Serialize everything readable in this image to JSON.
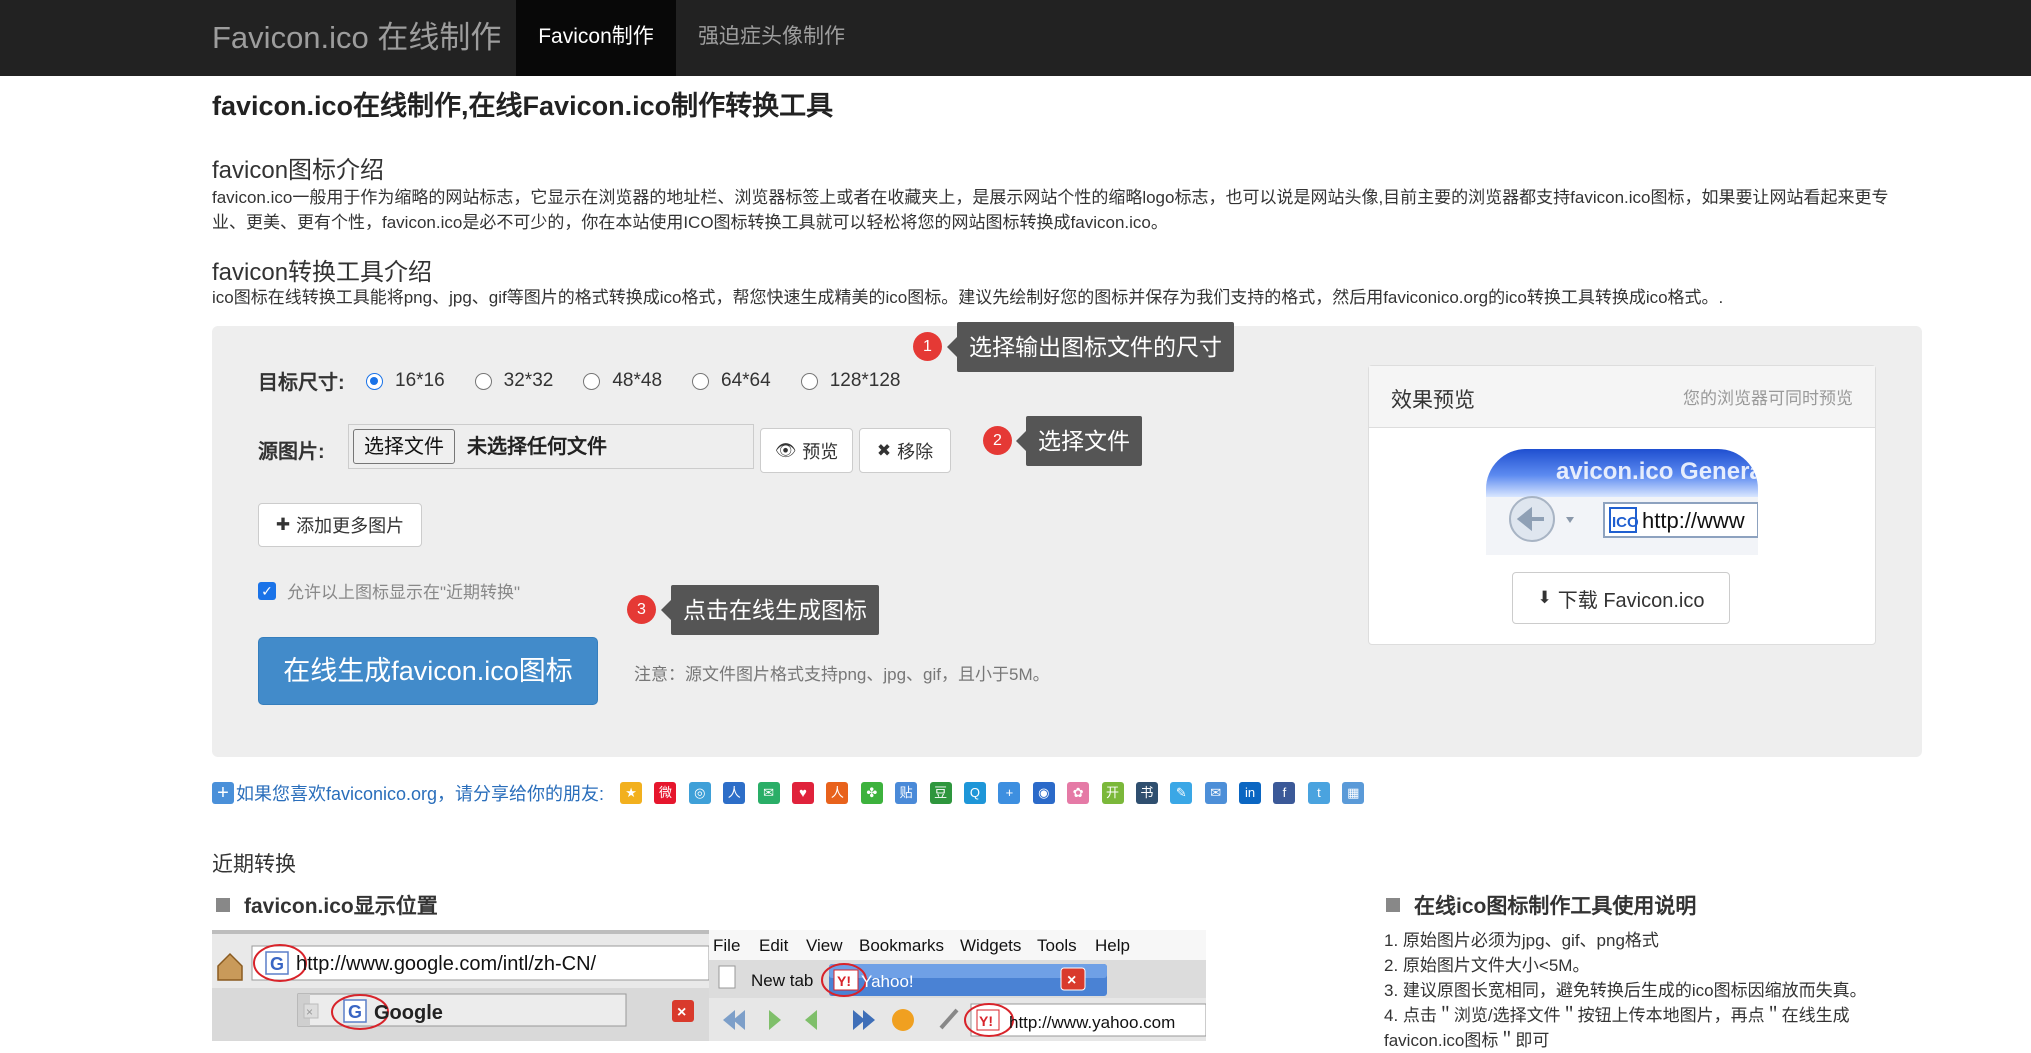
{
  "navbar": {
    "brand": "Favicon.ico 在线制作",
    "items": [
      {
        "label": "Favicon制作",
        "active": true
      },
      {
        "label": "强迫症头像制作",
        "active": false
      }
    ]
  },
  "page_title": "favicon.ico在线制作,在线Favicon.ico制作转换工具",
  "intro": {
    "heading": "favicon图标介绍",
    "text": "favicon.ico一般用于作为缩略的网站标志，它显示在浏览器的地址栏、浏览器标签上或者在收藏夹上，是展示网站个性的缩略logo标志，也可以说是网站头像,目前主要的浏览器都支持favicon.ico图标，如果要让网站看起来更专业、更美、更有个性，favicon.ico是必不可少的，你在本站使用ICO图标转换工具就可以轻松将您的网站图标转换成favicon.ico。"
  },
  "tool_intro": {
    "heading": "favicon转换工具介绍",
    "text": "ico图标在线转换工具能将png、jpg、gif等图片的格式转换成ico格式，帮您快速生成精美的ico图标。建议先绘制好您的图标并保存为我们支持的格式，然后用faviconico.org的ico转换工具转换成ico格式。."
  },
  "form": {
    "size_label": "目标尺寸:",
    "sizes": [
      "16*16",
      "32*32",
      "48*48",
      "64*64",
      "128*128"
    ],
    "selected_size": "16*16",
    "source_label": "源图片:",
    "file_button": "选择文件",
    "file_status": "未选择任何文件",
    "preview_button": "预览",
    "remove_button": "移除",
    "add_more_button": "添加更多图片",
    "allow_recent_label": "允许以上图标显示在\"近期转换\"",
    "allow_recent_checked": true,
    "generate_button": "在线生成favicon.ico图标",
    "note": "注意：源文件图片格式支持png、jpg、gif，且小于5M。"
  },
  "tips": [
    {
      "num": "1",
      "text": "选择输出图标文件的尺寸"
    },
    {
      "num": "2",
      "text": "选择文件"
    },
    {
      "num": "3",
      "text": "点击在线生成图标"
    }
  ],
  "preview": {
    "title": "效果预览",
    "hint": "您的浏览器可同时预览",
    "image_caption": "avicon.ico Genera",
    "image_url_text": "http://www",
    "image_ico_text": "ICO",
    "download_button": "下载 Favicon.ico"
  },
  "share": {
    "text": "如果您喜欢faviconico.org，请分享给你的朋友:",
    "icons": [
      {
        "name": "qzone-icon",
        "color": "#f2b01e"
      },
      {
        "name": "weibo-icon",
        "color": "#e6162d"
      },
      {
        "name": "tencent-weibo-icon",
        "color": "#3fa0d8"
      },
      {
        "name": "baidu-icon",
        "color": "#2d6ec8"
      },
      {
        "name": "wechat-icon",
        "color": "#2aae67"
      },
      {
        "name": "heart-icon",
        "color": "#e0223b"
      },
      {
        "name": "renren-icon",
        "color": "#e8621c"
      },
      {
        "name": "clover-icon",
        "color": "#3db23d"
      },
      {
        "name": "tieba-icon",
        "color": "#4a8ad8"
      },
      {
        "name": "douban-icon",
        "color": "#2e963d"
      },
      {
        "name": "qq-icon",
        "color": "#1e96d8"
      },
      {
        "name": "plus-share-icon",
        "color": "#3d8fe0"
      },
      {
        "name": "people-icon",
        "color": "#2b6ac9"
      },
      {
        "name": "flower-icon",
        "color": "#e57aa6"
      },
      {
        "name": "kaixin-icon",
        "color": "#7bb83a"
      },
      {
        "name": "bookmark-icon",
        "color": "#2f4f6f"
      },
      {
        "name": "pen-icon",
        "color": "#3aa7e6"
      },
      {
        "name": "mail-icon",
        "color": "#4d8fd8"
      },
      {
        "name": "linkedin-icon",
        "color": "#0b66c2"
      },
      {
        "name": "facebook-icon",
        "color": "#3b5998"
      },
      {
        "name": "twitter-icon",
        "color": "#4aa3df"
      },
      {
        "name": "table-icon",
        "color": "#5a9ad8"
      }
    ]
  },
  "recent": {
    "heading": "近期转换",
    "display_position_title": "favicon.ico显示位置",
    "usage_title": "在线ico图标制作工具使用说明",
    "usage_items": [
      "1. 原始图片必须为jpg、gif、png格式",
      "2. 原始图片文件大小<5M。",
      "3. 建议原图长宽相同，避免转换后生成的ico图标因缩放而失真。",
      "4. 点击＂浏览/选择文件＂按钮上传本地图片，再点＂在线生成",
      "favicon.ico图标＂即可"
    ]
  },
  "screenshot_left": {
    "url": "http://www.google.com/intl/zh-CN/",
    "tab": "Google"
  },
  "screenshot_right": {
    "menu": [
      "File",
      "Edit",
      "View",
      "Bookmarks",
      "Widgets",
      "Tools",
      "Help"
    ],
    "tab_new": "New tab",
    "tab_yahoo": "Yahoo!",
    "url": "http://www.yahoo.com"
  }
}
